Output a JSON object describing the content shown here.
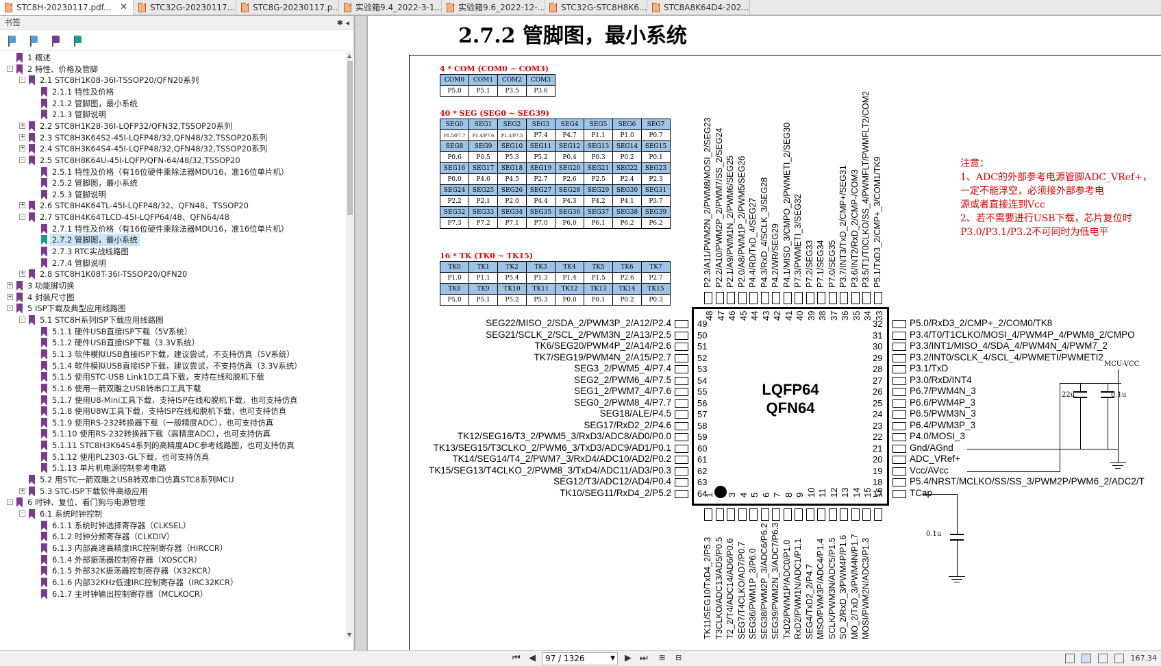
{
  "tabs": [
    {
      "label": "STC8H-20230117.pdf...",
      "active": true
    },
    {
      "label": "STC32G-20230117...."
    },
    {
      "label": "STC8G-20230117.p..."
    },
    {
      "label": "实验箱9.4_2022-3-1..."
    },
    {
      "label": "实验箱9.6_2022-12-..."
    },
    {
      "label": "STC32G-STC8H8K6..."
    },
    {
      "label": "STC8A8K64D4-202..."
    }
  ],
  "sidebar": {
    "title": "书签",
    "controls": "✱ ◂",
    "items": [
      {
        "level": 0,
        "label": "1 概述",
        "exp": ""
      },
      {
        "level": 0,
        "label": "2 特性、价格及管脚",
        "exp": "-"
      },
      {
        "level": 1,
        "label": "2.1 STC8H1K08-36I-TSSOP20/QFN20系列",
        "exp": "-"
      },
      {
        "level": 2,
        "label": "2.1.1 特性及价格"
      },
      {
        "level": 2,
        "label": "2.1.2 管脚图，最小系统"
      },
      {
        "level": 2,
        "label": "2.1.3 管脚说明"
      },
      {
        "level": 1,
        "label": "2.2 STC8H1K28-36I-LQFP32/QFN32,TSSOP20系列",
        "exp": "+"
      },
      {
        "level": 1,
        "label": "2.3 STC8H3K64S2-45I-LQFP48/32,QFN48/32,TSSOP20系列",
        "exp": "+"
      },
      {
        "level": 1,
        "label": "2.4 STC8H3K64S4-45I-LQFP48/32,QFN48/32,TSSOP20系列",
        "exp": "+"
      },
      {
        "level": 1,
        "label": "2.5 STC8H8K64U-45I-LQFP/QFN-64/48/32,TSSOP20",
        "exp": "-"
      },
      {
        "level": 2,
        "label": "2.5.1 特性及价格（有16位硬件乘除法器MDU16，准16位单片机）"
      },
      {
        "level": 2,
        "label": "2.5.2 管脚图，最小系统"
      },
      {
        "level": 2,
        "label": "2.5.3 管脚说明"
      },
      {
        "level": 1,
        "label": "2.6 STC8H4K64TL-45I-LQFP48/32、QFN48、TSSOP20",
        "exp": "+"
      },
      {
        "level": 1,
        "label": "2.7 STC8H4K64TLCD-45I-LQFP64/48、QFN64/48",
        "exp": "-"
      },
      {
        "level": 2,
        "label": "2.7.1 特性及价格（有16位硬件乘除法器MDU16，准16位单片机）"
      },
      {
        "level": 2,
        "label": "2.7.2 管脚图，最小系统",
        "selected": true
      },
      {
        "level": 2,
        "label": "2.7.3 RTC实战线路图"
      },
      {
        "level": 2,
        "label": "2.7.4 管脚说明"
      },
      {
        "level": 1,
        "label": "2.8 STC8H1K08T-36I-TSSOP20/QFN20",
        "exp": "+"
      },
      {
        "level": 0,
        "label": "3 功能脚切换",
        "exp": "+"
      },
      {
        "level": 0,
        "label": "4 封装尺寸图",
        "exp": "+"
      },
      {
        "level": 0,
        "label": "5 ISP下载及典型应用线路图",
        "exp": "-"
      },
      {
        "level": 1,
        "label": "5.1 STC8H系列ISP下载应用线路图",
        "exp": "-"
      },
      {
        "level": 2,
        "label": "5.1.1 硬件USB直接ISP下载（5V系统）"
      },
      {
        "level": 2,
        "label": "5.1.2 硬件USB直接ISP下载（3.3V系统）"
      },
      {
        "level": 2,
        "label": "5.1.3 软件模拟USB直接ISP下载，建议尝试，不支持仿真（5V系统）"
      },
      {
        "level": 2,
        "label": "5.1.4 软件模拟USB直接ISP下载，建议尝试，不支持仿真（3.3V系统）"
      },
      {
        "level": 2,
        "label": "5.1.5 使用STC-USB Link1D工具下载，支持在线和脱机下载"
      },
      {
        "level": 2,
        "label": "5.1.6 使用一箭双雕之USB转串口工具下载"
      },
      {
        "level": 2,
        "label": "5.1.7 使用U8-Mini工具下载，支持ISP在线和脱机下载，也可支持仿真"
      },
      {
        "level": 2,
        "label": "5.1.8 使用U8W工具下载，支持ISP在线和脱机下载，也可支持仿真"
      },
      {
        "level": 2,
        "label": "5.1.9 使用RS-232转换器下载（一般精度ADC），也可支持仿真"
      },
      {
        "level": 2,
        "label": "5.1.10 使用RS-232转换器下载（高精度ADC），也可支持仿真"
      },
      {
        "level": 2,
        "label": "5.1.11 STC8H3K64S4系列的高精度ADC参考线路图，也可支持仿真"
      },
      {
        "level": 2,
        "label": "5.1.12 使用PL2303-GL下载，也可支持仿真"
      },
      {
        "level": 2,
        "label": "5.1.13 单片机电源控制参考电路"
      },
      {
        "level": 1,
        "label": "5.2 用STC一箭双雕之USB转双串口仿真STC8系列MCU"
      },
      {
        "level": 1,
        "label": "5.3 STC-ISP下载软件高级应用",
        "exp": "+"
      },
      {
        "level": 0,
        "label": "6 时钟、复位、看门狗与电源管理",
        "exp": "-"
      },
      {
        "level": 1,
        "label": "6.1 系统时钟控制",
        "exp": "-"
      },
      {
        "level": 2,
        "label": "6.1.1 系统时钟选择寄存器（CLKSEL）"
      },
      {
        "level": 2,
        "label": "6.1.2 时钟分频寄存器（CLKDIV）"
      },
      {
        "level": 2,
        "label": "6.1.3 内部高速高精度IRC控制寄存器（HIRCCR）"
      },
      {
        "level": 2,
        "label": "6.1.4 外部振荡器控制寄存器（XOSCCR）"
      },
      {
        "level": 2,
        "label": "6.1.5 外部32K振荡器控制寄存器（X32KCR）"
      },
      {
        "level": 2,
        "label": "6.1.6 内部32KHz低速IRC控制寄存器（IRC32KCR）"
      },
      {
        "level": 2,
        "label": "6.1.7 主时钟输出控制寄存器（MCLKOCR）"
      }
    ]
  },
  "doc": {
    "heading": "2.7.2    管脚图，最小系统",
    "com_title": "4 * COM (COM0 ~ COM3)",
    "com": [
      [
        "COM0",
        "COM1",
        "COM2",
        "COM3"
      ],
      [
        "P5.0",
        "P5.1",
        "P3.5",
        "P3.6"
      ]
    ],
    "seg_title": "40 * SEG (SEG0 ~ SEG39)",
    "seg": [
      [
        "SEG0",
        "SEG1",
        "SEG2",
        "SEG3",
        "SEG4",
        "SEG5",
        "SEG6",
        "SEG7"
      ],
      [
        "P1.5/P7.7",
        "P1.4/P7.6",
        "P1.3/P7.5",
        "P7.4",
        "P4.7",
        "P1.1",
        "P1.0",
        "P0.7"
      ],
      [
        "SEG8",
        "SEG9",
        "SEG10",
        "SEG11",
        "SEG12",
        "SEG13",
        "SEG14",
        "SEG15"
      ],
      [
        "P0.6",
        "P0.5",
        "P5.3",
        "P5.2",
        "P0.4",
        "P0.3",
        "P0.2",
        "P0.1"
      ],
      [
        "SEG16",
        "SEG17",
        "SEG18",
        "SEG19",
        "SEG20",
        "SEG21",
        "SEG22",
        "SEG23"
      ],
      [
        "P0.0",
        "P4.6",
        "P4.5",
        "P2.7",
        "P2.6",
        "P2.5",
        "P2.4",
        "P2.3"
      ],
      [
        "SEG24",
        "SEG25",
        "SEG26",
        "SEG27",
        "SEG28",
        "SEG29",
        "SEG30",
        "SEG31"
      ],
      [
        "P2.2",
        "P2.1",
        "P2.0",
        "P4.4",
        "P4.3",
        "P4.2",
        "P4.1",
        "P3.7"
      ],
      [
        "SEG32",
        "SEG33",
        "SEG34",
        "SEG35",
        "SEG36",
        "SEG37",
        "SEG38",
        "SEG39"
      ],
      [
        "P7.3",
        "P7.2",
        "P7.1",
        "P7.0",
        "P6.0",
        "P6.1",
        "P6.2",
        "P6.2"
      ]
    ],
    "tk_title": "16 * TK (TK0 ~ TK15)",
    "tk": [
      [
        "TK0",
        "TK1",
        "TK2",
        "TK3",
        "TK4",
        "TK5",
        "TK6",
        "TK7"
      ],
      [
        "P1.0",
        "P1.1",
        "P5.4",
        "P1.3",
        "P1.4",
        "P1.5",
        "P2.6",
        "P2.7"
      ],
      [
        "TK8",
        "TK9",
        "TK10",
        "TK11",
        "TK12",
        "TK13",
        "TK14",
        "TK15"
      ],
      [
        "P5.0",
        "P5.1",
        "P5.2",
        "P5.3",
        "P0.0",
        "P0.1",
        "P0.2",
        "P0.3"
      ]
    ],
    "notes": [
      "注意：",
      "1、ADC的外部参考电源管脚ADC_VRef+，",
      "     一定不能浮空，必须接外部参考电",
      "     源或者直接连到Vcc",
      "2、若不需要进行USB下载，芯片复位时",
      "     P3.0/P3.1/P3.2不可同时为低电平"
    ],
    "chip": [
      "LQFP64",
      "QFN64"
    ],
    "left_pins": [
      {
        "n": "49",
        "t": "SEG22/MISO_2/SDA_2/PWM3P_2/A12/P2.4"
      },
      {
        "n": "50",
        "t": "SEG21/SCLK_2/SCL_2/PWM3N_2/A13/P2.5"
      },
      {
        "n": "51",
        "t": "TK6/SEG20/PWM4P_2/A14/P2.6"
      },
      {
        "n": "52",
        "t": "TK7/SEG19/PWM4N_2/A15/P2.7"
      },
      {
        "n": "53",
        "t": "SEG3_2/PWM5_4/P7.4"
      },
      {
        "n": "54",
        "t": "SEG2_2/PWM6_4/P7.5"
      },
      {
        "n": "55",
        "t": "SEG1_2/PWM7_4/P7.6"
      },
      {
        "n": "56",
        "t": "SEG0_2/PWM8_4/P7.7"
      },
      {
        "n": "57",
        "t": "SEG18/ALE/P4.5"
      },
      {
        "n": "58",
        "t": "SEG17/RxD2_2/P4.6"
      },
      {
        "n": "59",
        "t": "TK12/SEG16/T3_2/PWM5_3/RxD3/ADC8/AD0/P0.0"
      },
      {
        "n": "60",
        "t": "TK13/SEG15/T3CLKO_2/PWM6_3/TxD3/ADC9/AD1/P0.1"
      },
      {
        "n": "61",
        "t": "TK14/SEG14/T4_2/PWM7_3/RxD4/ADC10/AD2/P0.2"
      },
      {
        "n": "62",
        "t": "TK15/SEG13/T4CLKO_2/PWM8_3/TxD4/ADC11/AD3/P0.3"
      },
      {
        "n": "63",
        "t": "SEG12/T3/ADC12/AD4/P0.4"
      },
      {
        "n": "64",
        "t": "TK10/SEG11/RxD4_2/P5.2"
      }
    ],
    "right_pins": [
      {
        "n": "32",
        "t": "P5.0/RxD3_2/CMP+_2/COM0/TK8"
      },
      {
        "n": "31",
        "t": "P3.4/T0/T1CLKO/MOSI_4/PWM4P_4/PWM8_2/CMPO"
      },
      {
        "n": "30",
        "t": "P3.3/INT1/MISO_4/SDA_4/PWM4N_4/PWM7_2"
      },
      {
        "n": "29",
        "t": "P3.2/INT0/SCLK_4/SCL_4/PWMETI/PWMETI2"
      },
      {
        "n": "28",
        "t": "P3.1/TxD"
      },
      {
        "n": "27",
        "t": "P3.0/RxD/INT4"
      },
      {
        "n": "26",
        "t": "P6.7/PWM4N_3"
      },
      {
        "n": "25",
        "t": "P6.6/PWM4P_3"
      },
      {
        "n": "24",
        "t": "P6.5/PWM3N_3"
      },
      {
        "n": "23",
        "t": "P6.4/PWM3P_3"
      },
      {
        "n": "22",
        "t": "P4.0/MOSI_3"
      },
      {
        "n": "21",
        "t": "Gnd/AGnd"
      },
      {
        "n": "20",
        "t": "ADC_VRef+"
      },
      {
        "n": "19",
        "t": "Vcc/AVcc"
      },
      {
        "n": "18",
        "t": "P5.4/NRST/MCLKO/SS/SS_3/PWM2P/PWM6_2/ADC2/T"
      },
      {
        "n": "17",
        "t": "TCap"
      }
    ],
    "top_pins": [
      {
        "n": "48",
        "t": "P2.3/A11/PWM2N_2/PWM8/MOSI_2/SEG23"
      },
      {
        "n": "47",
        "t": "P2.2/A10/PWM2P_2/PWM7/SS_2/SEG24"
      },
      {
        "n": "46",
        "t": "P2.1/A9/PWM1N_2/PWM6/SEG25"
      },
      {
        "n": "45",
        "t": "P2.0/A8/PWM1P_2/PWM5/SEG26"
      },
      {
        "n": "44",
        "t": "P4.4/RD/TxD_4/SEG27"
      },
      {
        "n": "43",
        "t": "P4.3/RxD_4/SCLK_3/SEG28"
      },
      {
        "n": "42",
        "t": "P4.2/WR/SEG29"
      },
      {
        "n": "41",
        "t": "P4.1/MISO_3/CMPO_2/PWMETI_2/SEG30"
      },
      {
        "n": "40",
        "t": "P7.3/PWMETI_3/SEG32"
      },
      {
        "n": "39",
        "t": "P7.2/SEG33"
      },
      {
        "n": "38",
        "t": "P7.1/SEG34"
      },
      {
        "n": "37",
        "t": "P7.0/SEG35"
      },
      {
        "n": "36",
        "t": "P3.7/INT3/TxD_2/CMP+/SEG31"
      },
      {
        "n": "35",
        "t": "P3.6/INT2/RxD_2/CMP-/COM3"
      },
      {
        "n": "34",
        "t": "P3.5/T1/T0CLKO/SS_4/PWMFLT/PWMFLT2/COM2"
      },
      {
        "n": "33",
        "t": "P5.1/TxD3_2/CMP+_3/COM1/TK9"
      }
    ],
    "bottom_pins": [
      {
        "n": "1",
        "t": "TK11/SEG10/TxD4_2/P5.3"
      },
      {
        "n": "2",
        "t": "T3CLKO/ADC13/AD5/P0.5"
      },
      {
        "n": "3",
        "t": "T2_2/T4/ADC14/AD6/P0.6"
      },
      {
        "n": "4",
        "t": "SEG7/T4CLKO/AD7/P0.7"
      },
      {
        "n": "5",
        "t": "SEG36/PWM1P_3/P6.0"
      },
      {
        "n": "6",
        "t": "SEG38/PWM2P_3/ADC6/P6.2"
      },
      {
        "n": "7",
        "t": "SEG39/PWM2N_3/ADC7/P6.3"
      },
      {
        "n": "8",
        "t": "TxD2/PWM1P/ADC0/P1.0"
      },
      {
        "n": "9",
        "t": "RxD2/PWM1N/ADC1/P1.1"
      },
      {
        "n": "10",
        "t": "SEG4/TxD2_2/P4.7"
      },
      {
        "n": "11",
        "t": "MISO/PWM3P/ADC4/P1.4"
      },
      {
        "n": "12",
        "t": "SCLK/PWM3N/ADC5/P1.5"
      },
      {
        "n": "13",
        "t": "SO_2/RxD_3/PWM4P/P1.6"
      },
      {
        "n": "14",
        "t": "MO_2/TxD_3/PWM4N/P1.7"
      },
      {
        "n": "15",
        "t": "MOSI/PWM2N/ADC3/P1.3"
      },
      {
        "n": "16",
        "t": ""
      }
    ],
    "mcu_vcc": "MCU-VCC",
    "cap1": "22u",
    "cap2": "0.1u",
    "cap3": "0.1u"
  },
  "status": {
    "page": "97 / 1326",
    "zoom": "167.34"
  }
}
